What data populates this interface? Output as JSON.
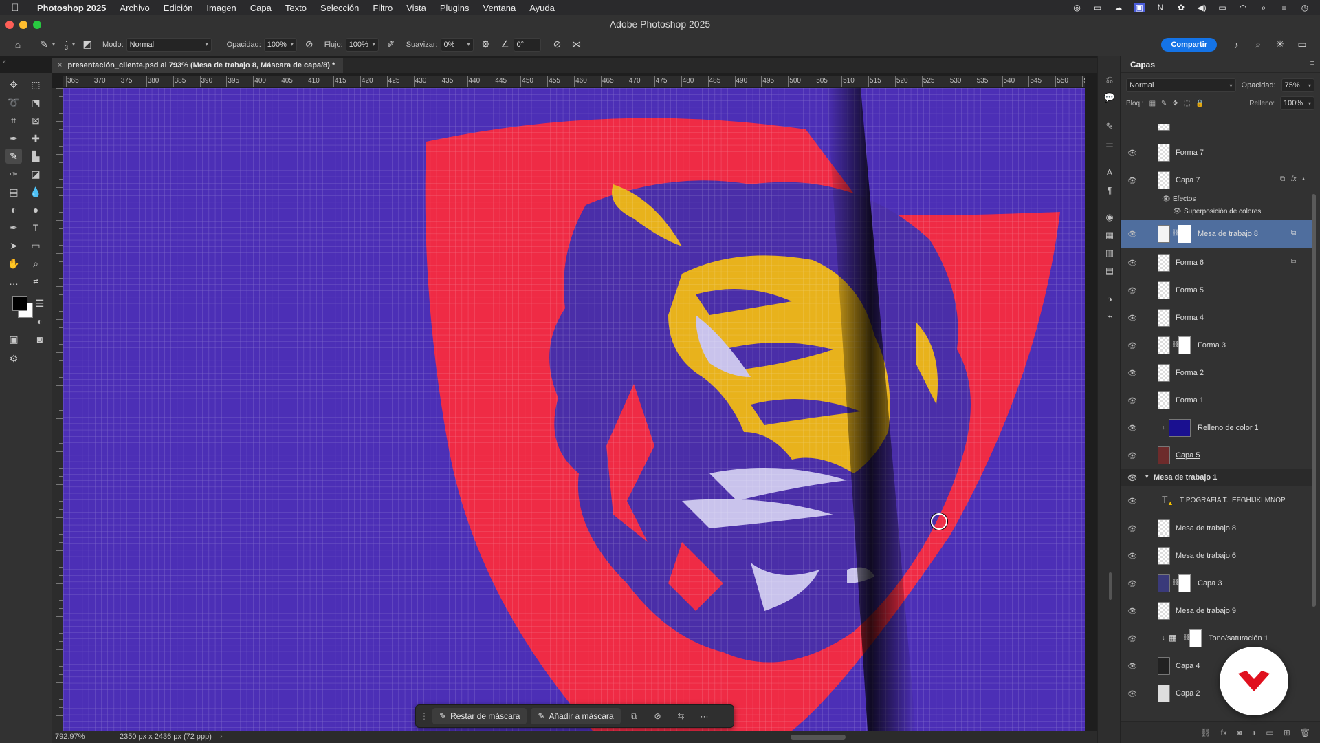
{
  "menubar": {
    "app": "Photoshop 2025",
    "items": [
      "Archivo",
      "Edición",
      "Imagen",
      "Capa",
      "Texto",
      "Selección",
      "Filtro",
      "Vista",
      "Plugins",
      "Ventana",
      "Ayuda"
    ]
  },
  "window": {
    "title": "Adobe Photoshop 2025"
  },
  "options": {
    "brush_size": "3",
    "mode_label": "Modo:",
    "mode_value": "Normal",
    "opacity_label": "Opacidad:",
    "opacity_value": "100%",
    "flow_label": "Flujo:",
    "flow_value": "100%",
    "smooth_label": "Suavizar:",
    "smooth_value": "0%",
    "angle_value": "0°",
    "share_label": "Compartir"
  },
  "document": {
    "tab_title": "presentación_cliente.psd al 793% (Mesa de trabajo 8, Máscara de capa/8) *"
  },
  "ruler": {
    "ticks": [
      "365",
      "370",
      "375",
      "380",
      "385",
      "390",
      "395",
      "400",
      "405",
      "410",
      "415",
      "420",
      "425",
      "430",
      "435",
      "440",
      "445",
      "450",
      "455",
      "460",
      "465",
      "470",
      "475",
      "480",
      "485",
      "490",
      "495",
      "500",
      "505",
      "510",
      "515",
      "520",
      "525",
      "530",
      "535",
      "540",
      "545",
      "550",
      "55"
    ]
  },
  "status": {
    "zoom": "792.97%",
    "dimensions": "2350 px x 2436 px (72 ppp)"
  },
  "maskbar": {
    "subtract_label": "Restar de máscara",
    "add_label": "Añadir a máscara"
  },
  "layers_panel": {
    "title": "Capas",
    "blend_mode": "Normal",
    "opacity_label": "Opacidad:",
    "opacity_value": "75%",
    "lock_label": "Bloq.:",
    "fill_label": "Relleno:",
    "fill_value": "100%",
    "layers": [
      {
        "name": "Forma 7"
      },
      {
        "name": "Capa 7"
      },
      {
        "name": "Efectos"
      },
      {
        "name": "Superposición de colores"
      },
      {
        "name": "Mesa de trabajo 8"
      },
      {
        "name": "Forma 6"
      },
      {
        "name": "Forma 5"
      },
      {
        "name": "Forma 4"
      },
      {
        "name": "Forma 3"
      },
      {
        "name": "Forma 2"
      },
      {
        "name": "Forma 1"
      },
      {
        "name": "Relleno de color 1"
      },
      {
        "name": "Capa 5"
      },
      {
        "name": "Mesa de trabajo 1"
      },
      {
        "name": "TIPOGRAFIA T...EFGHIJKLMNOP"
      },
      {
        "name": "Mesa de trabajo 8"
      },
      {
        "name": "Mesa de trabajo 6"
      },
      {
        "name": "Capa 3"
      },
      {
        "name": "Mesa de trabajo 9"
      },
      {
        "name": "Tono/saturación 1"
      },
      {
        "name": "Capa 4"
      },
      {
        "name": "Capa 2"
      }
    ]
  },
  "colors": {
    "canvas_bg": "#4c2fb6",
    "shield_red": "#ef2b45",
    "tiger_purple": "#4a2ea8",
    "tiger_yellow": "#e8b21c",
    "tiger_white": "#c9c3ec",
    "accent_blue": "#1473e6",
    "selected_layer": "#4f6e9e"
  }
}
